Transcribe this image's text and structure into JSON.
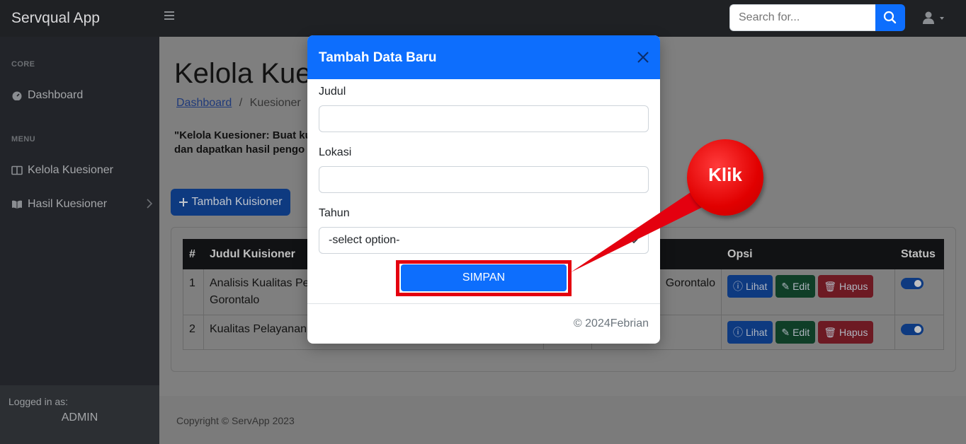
{
  "app": {
    "brand": "Servqual App"
  },
  "topnav": {
    "search_placeholder": "Search for..."
  },
  "sidebar": {
    "sections": [
      {
        "heading": "CORE",
        "items": [
          {
            "label": "Dashboard",
            "icon": "tachometer-icon"
          }
        ]
      },
      {
        "heading": "MENU",
        "items": [
          {
            "label": "Kelola Kuesioner",
            "icon": "columns-icon"
          },
          {
            "label": "Hasil Kuesioner",
            "icon": "book-open-icon",
            "has_chevron": true
          }
        ]
      }
    ],
    "footer": {
      "label": "Logged in as:",
      "user": "ADMIN"
    }
  },
  "main": {
    "title": "Kelola Kue",
    "breadcrumb": {
      "link": "Dashboard",
      "separator": "/",
      "current": "Kuesioner"
    },
    "description_line1": "\"Kelola Kuesioner: Buat ku",
    "description_line2": "dan dapatkan hasil pengo",
    "add_button": "Tambah Kuisioner",
    "table": {
      "headers": [
        "#",
        "Judul Kuisioner",
        "",
        "",
        "Opsi",
        "Status"
      ],
      "rows": [
        {
          "no": "1",
          "judul": "Analisis Kualitas Pela",
          "judul_cont": "Gorontalo",
          "lokasi": "Gorontalo",
          "status_on": true
        },
        {
          "no": "2",
          "judul": "Kualitas Pelayanan D",
          "judul_cont": "",
          "lokasi": "",
          "status_on": true
        }
      ],
      "actions": {
        "view": "Lihat",
        "edit": "Edit",
        "delete": "Hapus"
      }
    },
    "copyright": "Copyright © ServApp 2023"
  },
  "modal": {
    "title": "Tambah Data Baru",
    "fields": {
      "judul_label": "Judul",
      "lokasi_label": "Lokasi",
      "tahun_label": "Tahun",
      "tahun_selected": "-select option-"
    },
    "save_button": "SIMPAN",
    "footer": "© 2024Febrian"
  },
  "annotation": {
    "callout_text": "Klik",
    "color": "#e4000f"
  },
  "colors": {
    "primary": "#0d6efd",
    "success": "#198754",
    "danger": "#dc3545",
    "navbar": "#1f2124"
  }
}
